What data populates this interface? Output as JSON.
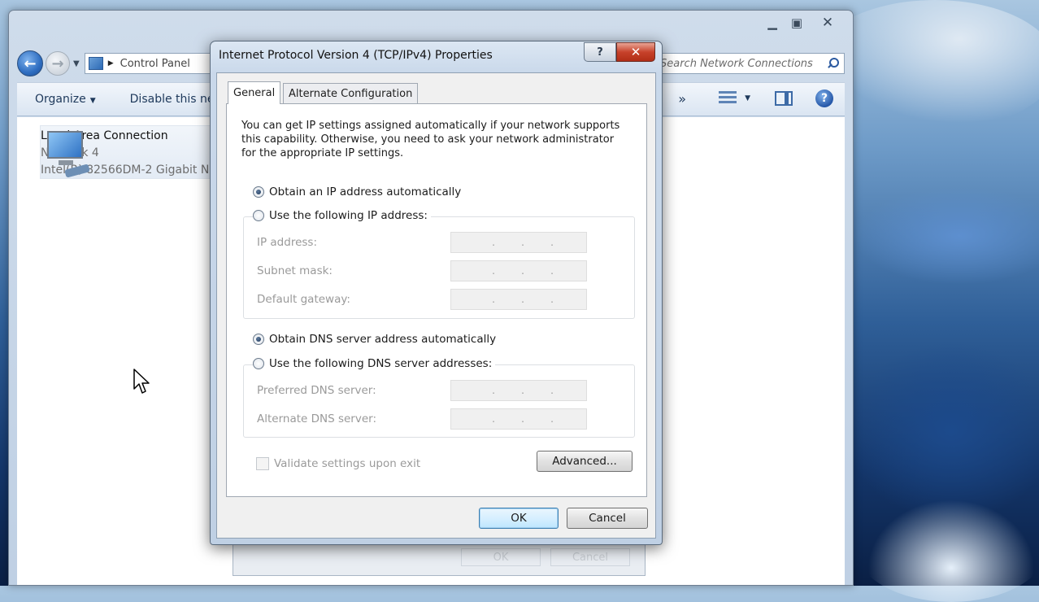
{
  "explorer": {
    "address_text": "Control Panel",
    "search_placeholder": "Search Network Connections",
    "toolbar": {
      "organize_label": "Organize",
      "disable_label": "Disable this network device"
    },
    "connection": {
      "name": "Local Area Connection",
      "network": "Network 4",
      "adapter": "Intel(R) 82566DM-2 Gigabit Network Connection"
    },
    "ghost_buttons": {
      "ok": "OK",
      "cancel": "Cancel"
    }
  },
  "dialog": {
    "title": "Internet Protocol Version 4 (TCP/IPv4) Properties",
    "help_glyph": "?",
    "close_glyph": "✕",
    "tabs": [
      {
        "label": "General",
        "active": true
      },
      {
        "label": "Alternate Configuration",
        "active": false
      }
    ],
    "intro_text": "You can get IP settings assigned automatically if your network supports this capability. Otherwise, you need to ask your network administrator for the appropriate IP settings.",
    "ip_options": {
      "auto_label": "Obtain an IP address automatically",
      "manual_label": "Use the following IP address:",
      "selected": "auto"
    },
    "ip_fields": [
      {
        "label": "IP address:",
        "value": " .   .   ."
      },
      {
        "label": "Subnet mask:",
        "value": " .   .   ."
      },
      {
        "label": "Default gateway:",
        "value": " .   .   ."
      }
    ],
    "dns_options": {
      "auto_label": "Obtain DNS server address automatically",
      "manual_label": "Use the following DNS server addresses:",
      "selected": "auto"
    },
    "dns_fields": [
      {
        "label": "Preferred DNS server:",
        "value": " .   .   ."
      },
      {
        "label": "Alternate DNS server:",
        "value": " .   .   ."
      }
    ],
    "validate_label": "Validate settings upon exit",
    "validate_checked": false,
    "advanced_label": "Advanced...",
    "ok_label": "OK",
    "cancel_label": "Cancel"
  }
}
